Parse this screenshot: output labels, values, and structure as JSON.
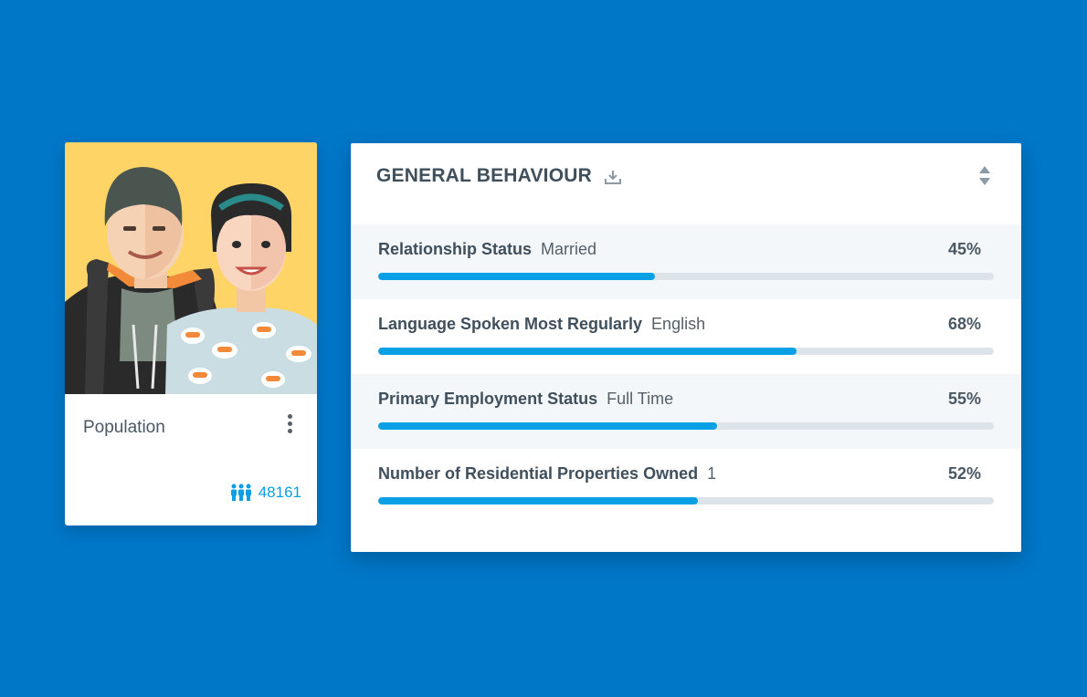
{
  "profile": {
    "label": "Population",
    "count": "48161",
    "icons": {
      "menu": "more-vertical-icon",
      "people": "people-group-icon"
    },
    "colors": {
      "portrait_bg": "#ffd466",
      "count": "#0a9ee4"
    }
  },
  "panel": {
    "title": "GENERAL BEHAVIOUR",
    "icons": {
      "download": "download-icon",
      "sort": "sort-updown-icon"
    },
    "colors": {
      "bar_fill": "#0aa0e6",
      "bar_track": "#dde4e9",
      "page_bg": "#0177c8"
    },
    "rows": [
      {
        "attribute": "Relationship Status",
        "value": "Married",
        "percent_label": "45%",
        "percent": 45
      },
      {
        "attribute": "Language Spoken Most Regularly",
        "value": "English",
        "percent_label": "68%",
        "percent": 68
      },
      {
        "attribute": "Primary Employment Status",
        "value": "Full Time",
        "percent_label": "55%",
        "percent": 55
      },
      {
        "attribute": "Number of Residential Properties Owned",
        "value": "1",
        "percent_label": "52%",
        "percent": 52
      }
    ]
  }
}
